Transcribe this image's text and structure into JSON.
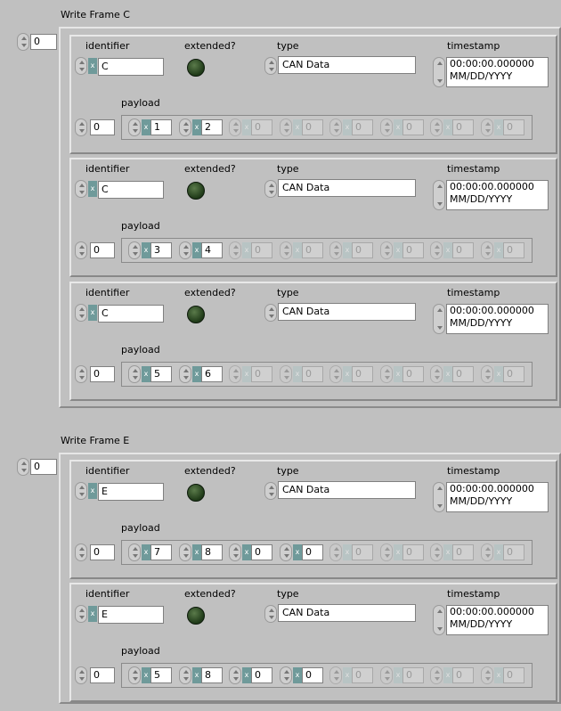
{
  "arrays": [
    {
      "title": "Write Frame C",
      "index": "0",
      "frames": [
        {
          "identifier_label": "identifier",
          "extended_label": "extended?",
          "type_label": "type",
          "timestamp_label": "timestamp",
          "payload_label": "payload",
          "identifier": "C",
          "type": "CAN Data",
          "timestamp_time": "00:00:00.000000",
          "timestamp_date": "MM/DD/YYYY",
          "payload_index": "0",
          "payload": [
            "1",
            "2",
            "0",
            "0",
            "0",
            "0",
            "0",
            "0"
          ],
          "payload_active": 2
        },
        {
          "identifier_label": "identifier",
          "extended_label": "extended?",
          "type_label": "type",
          "timestamp_label": "timestamp",
          "payload_label": "payload",
          "identifier": "C",
          "type": "CAN Data",
          "timestamp_time": "00:00:00.000000",
          "timestamp_date": "MM/DD/YYYY",
          "payload_index": "0",
          "payload": [
            "3",
            "4",
            "0",
            "0",
            "0",
            "0",
            "0",
            "0"
          ],
          "payload_active": 2
        },
        {
          "identifier_label": "identifier",
          "extended_label": "extended?",
          "type_label": "type",
          "timestamp_label": "timestamp",
          "payload_label": "payload",
          "identifier": "C",
          "type": "CAN Data",
          "timestamp_time": "00:00:00.000000",
          "timestamp_date": "MM/DD/YYYY",
          "payload_index": "0",
          "payload": [
            "5",
            "6",
            "0",
            "0",
            "0",
            "0",
            "0",
            "0"
          ],
          "payload_active": 2
        }
      ]
    },
    {
      "title": "Write Frame E",
      "index": "0",
      "frames": [
        {
          "identifier_label": "identifier",
          "extended_label": "extended?",
          "type_label": "type",
          "timestamp_label": "timestamp",
          "payload_label": "payload",
          "identifier": "E",
          "type": "CAN Data",
          "timestamp_time": "00:00:00.000000",
          "timestamp_date": "MM/DD/YYYY",
          "payload_index": "0",
          "payload": [
            "7",
            "8",
            "0",
            "0",
            "0",
            "0",
            "0",
            "0"
          ],
          "payload_active": 4
        },
        {
          "identifier_label": "identifier",
          "extended_label": "extended?",
          "type_label": "type",
          "timestamp_label": "timestamp",
          "payload_label": "payload",
          "identifier": "E",
          "type": "CAN Data",
          "timestamp_time": "00:00:00.000000",
          "timestamp_date": "MM/DD/YYYY",
          "payload_index": "0",
          "payload": [
            "5",
            "8",
            "0",
            "0",
            "0",
            "0",
            "0",
            "0"
          ],
          "payload_active": 4
        }
      ]
    }
  ],
  "radix_char": "x",
  "colors": {
    "led_off": "#2a4a22",
    "radix": "#6f9a9a",
    "background": "#c0c0c0"
  }
}
